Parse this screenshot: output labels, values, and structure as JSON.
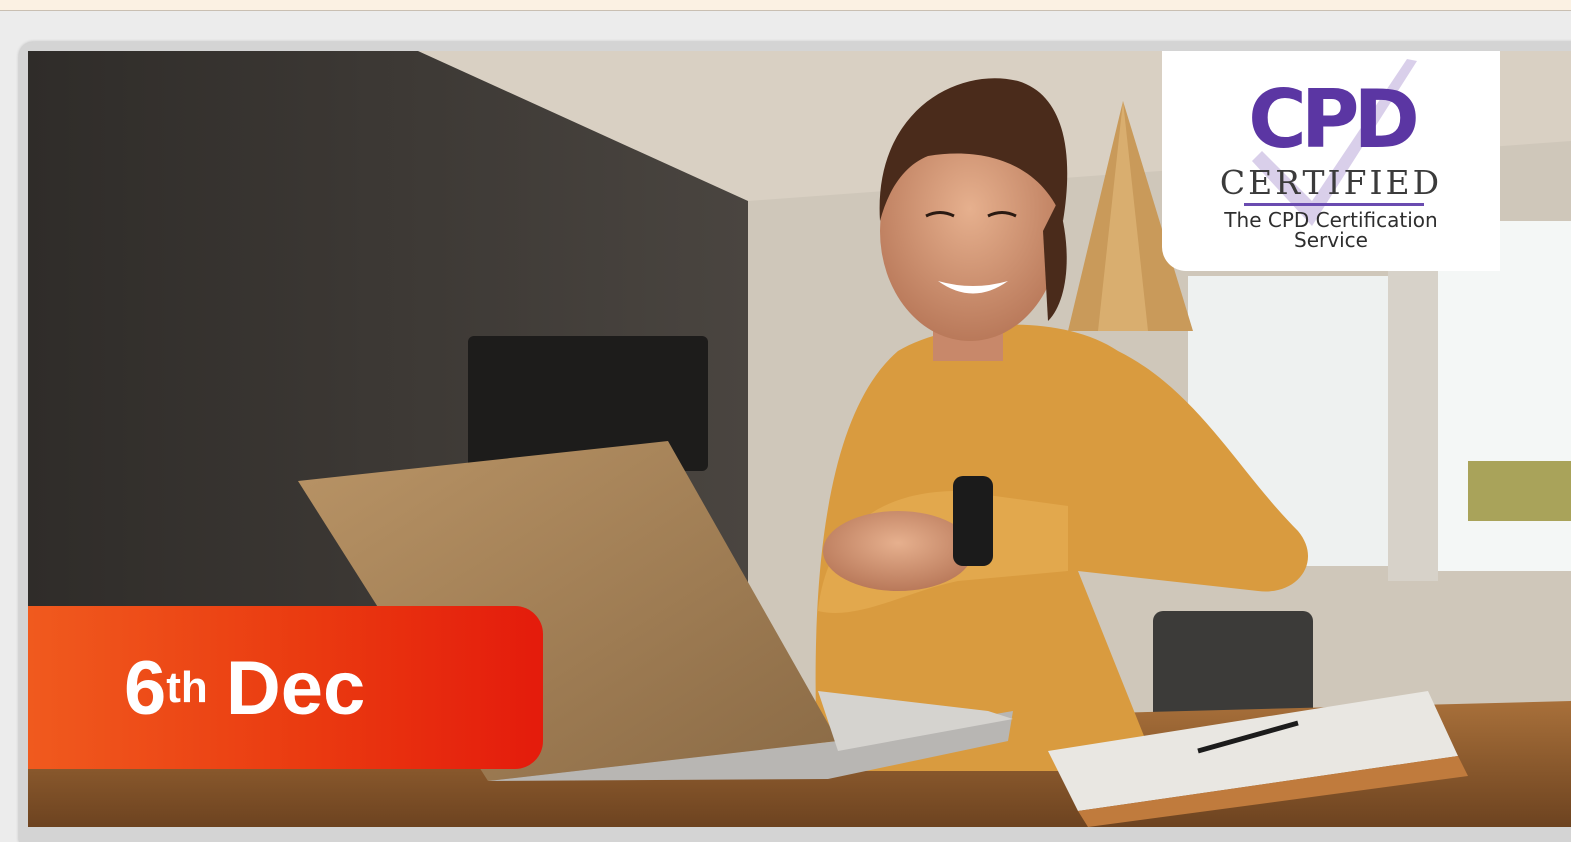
{
  "banner": {
    "image_alt": "Smiling woman in a yellow sweater checking her wristwatch at a desk with a laptop",
    "cpd_badge": {
      "logo_text": "CPD",
      "certified_text": "CERTIFIED",
      "service_line_1": "The CPD Certification",
      "service_line_2": "Service"
    },
    "date_badge": {
      "day": "6",
      "suffix": "th",
      "month": "Dec"
    }
  },
  "colors": {
    "date_badge_start": "#f05a1e",
    "date_badge_end": "#e41b0c",
    "cpd_purple": "#5b36a3"
  }
}
